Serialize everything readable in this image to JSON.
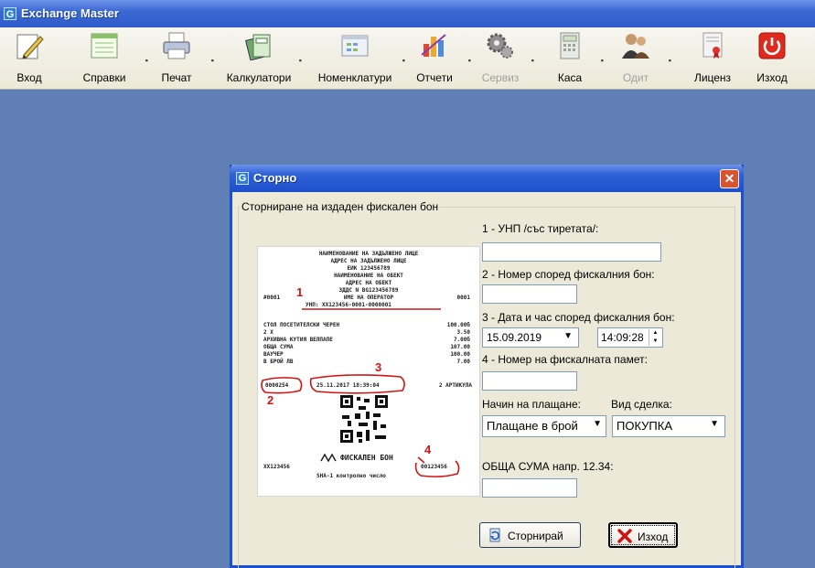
{
  "app": {
    "title": "Exchange Master",
    "logo": "G"
  },
  "toolbar": [
    {
      "id": "login",
      "label": "Вход",
      "icon": "pencil-icon",
      "has_arrow": false,
      "enabled": true
    },
    {
      "id": "reports",
      "label": "Справки",
      "icon": "document-list-icon",
      "has_arrow": true,
      "enabled": true
    },
    {
      "id": "print",
      "label": "Печат",
      "icon": "printer-icon",
      "has_arrow": true,
      "enabled": true
    },
    {
      "id": "calculators",
      "label": "Калкулатори",
      "icon": "calculator-cards-icon",
      "has_arrow": true,
      "enabled": true
    },
    {
      "id": "nomenclatures",
      "label": "Номенклатури",
      "icon": "grid-window-icon",
      "has_arrow": true,
      "enabled": true
    },
    {
      "id": "statements",
      "label": "Отчети",
      "icon": "bar-chart-icon",
      "has_arrow": true,
      "enabled": true
    },
    {
      "id": "service",
      "label": "Сервиз",
      "icon": "gears-icon",
      "has_arrow": true,
      "enabled": false
    },
    {
      "id": "cashdesk",
      "label": "Каса",
      "icon": "cash-register-icon",
      "has_arrow": true,
      "enabled": true
    },
    {
      "id": "audit",
      "label": "Одит",
      "icon": "users-icon",
      "has_arrow": true,
      "enabled": false
    },
    {
      "id": "license",
      "label": "Лиценз",
      "icon": "license-certificate-icon",
      "has_arrow": false,
      "enabled": true
    },
    {
      "id": "exit",
      "label": "Изход",
      "icon": "power-icon",
      "has_arrow": false,
      "enabled": true
    }
  ],
  "dialog": {
    "title": "Сторно",
    "logo": "G",
    "close_glyph": "✕",
    "group_title": "Сторниране на издаден фискален бон",
    "receipt": {
      "header_lines": [
        "НАИМЕНОВАНИЕ НА ЗАДЪЛЖЕНО ЛИЦЕ",
        "АДРЕС НА ЗАДЪЛЖЕНО ЛИЦЕ",
        "ЕИК 123456789",
        "НАИМЕНОВАНИЕ НА ОБЕКТ",
        "АДРЕС НА ОБЕКТ",
        "ЗДДС N BG123456789"
      ],
      "operator_left": "#0001",
      "operator_name": "ИМЕ НА ОПЕРАТОР",
      "operator_right": "0001",
      "unp_line": "УНП: XX123456-0001-0000001",
      "items": [
        {
          "name": "СТОЛ ПОСЕТИТЕЛСКИ ЧЕРЕН",
          "amount": "100.00б"
        },
        {
          "name": "  2 Х",
          "amount": "3.50"
        },
        {
          "name": "АРХИВНА КУТИЯ ВЕЛПАПЕ",
          "amount": "7.00б"
        },
        {
          "name": "ОБЩА СУМА",
          "amount": "107.00"
        },
        {
          "name": "ВАУЧЕР",
          "amount": "100.00"
        },
        {
          "name": "В БРОЙ ЛВ",
          "amount": "7.00"
        }
      ],
      "receipt_number": "0000254",
      "datetime": "25.11.2017  18:39:04",
      "articles": "2 АРТИКУЛА",
      "fiscal_label": "ФИСКАЛЕН БОН",
      "device_id": "XX123456",
      "memory_number": "00123456",
      "sha_line": "SHA-1 контролно число",
      "markers": [
        "1",
        "2",
        "3",
        "4"
      ]
    },
    "fields": {
      "unp_label": "1 - УНП /със тиретата/:",
      "unp_value": "",
      "receipt_no_label": "2 - Номер според фискалния бон:",
      "receipt_no_value": "",
      "datetime_label": "3 - Дата и час според фискалния бон:",
      "date_value": "15.09.2019",
      "time_value": "14:09:28",
      "fiscal_memory_label": "4 - Номер на фискалната памет:",
      "fiscal_memory_value": "",
      "payment_label": "Начин на плащане:",
      "payment_value": "Плащане в брой",
      "deal_label": "Вид сделка:",
      "deal_value": "ПОКУПКА",
      "total_label": "ОБЩА СУМА напр. 12.34:",
      "total_value": ""
    },
    "buttons": {
      "reverse_label": "Сторнирай",
      "exit_label": "Изход"
    }
  },
  "colors": {
    "desktop": "#5f7fb5",
    "titlebar": "#2f5cc8",
    "dialog_bg": "#ece9d8",
    "marker_red": "#d01515",
    "close_red": "#d9532f",
    "exit_x_red": "#d01010"
  }
}
